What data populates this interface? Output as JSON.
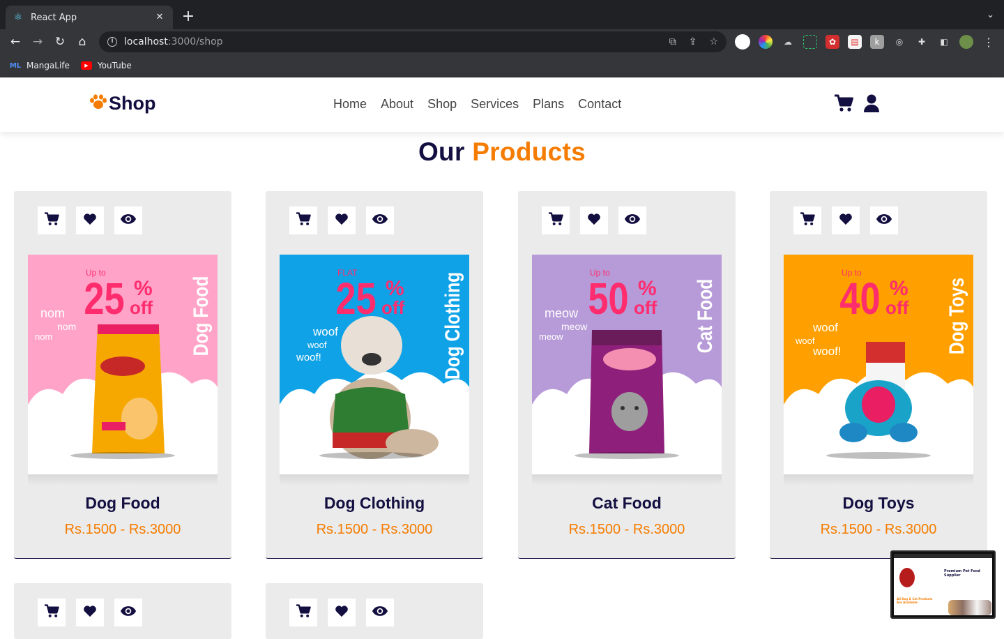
{
  "browser": {
    "tab_title": "React App",
    "new_tab_label": "+",
    "url_host": "localhost",
    "url_path": ":3000/shop",
    "bookmarks": [
      {
        "label": "MangaLife",
        "icon": "mangalife-icon"
      },
      {
        "label": "YouTube",
        "icon": "youtube-icon"
      }
    ]
  },
  "site": {
    "logo_text": "Shop",
    "nav": [
      "Home",
      "About",
      "Shop",
      "Services",
      "Plans",
      "Contact"
    ]
  },
  "section": {
    "title_prefix": "Our",
    "title_accent": "Products"
  },
  "products": [
    {
      "name": "Dog Food",
      "price": "Rs.1500 - Rs.3000",
      "banner": {
        "upto": "Up to",
        "percent": "25",
        "pct": "%",
        "off": "off",
        "side": "Dog Food",
        "sound": [
          "nom",
          "nom",
          "nom"
        ],
        "bg": "#ffa4c8",
        "accent": "#ff2c6e",
        "product_color": "#f6a800"
      }
    },
    {
      "name": "Dog Clothing",
      "price": "Rs.1500 - Rs.3000",
      "banner": {
        "upto": "FLAT",
        "percent": "25",
        "pct": "%",
        "off": "off",
        "side": "Dog Clothing",
        "sound": [
          "woof",
          "woof",
          "woof!"
        ],
        "bg": "#0fa2e6",
        "accent": "#ff2c6e",
        "product_color": "#e53935"
      }
    },
    {
      "name": "Cat Food",
      "price": "Rs.1500 - Rs.3000",
      "banner": {
        "upto": "Up to",
        "percent": "50",
        "pct": "%",
        "off": "off",
        "side": "Cat Food",
        "sound": [
          "meow",
          "meow",
          "meow"
        ],
        "bg": "#b79ad8",
        "accent": "#ff2c6e",
        "product_color": "#8e1f7a"
      }
    },
    {
      "name": "Dog Toys",
      "price": "Rs.1500 - Rs.3000",
      "banner": {
        "upto": "Up to",
        "percent": "40",
        "pct": "%",
        "off": "off",
        "side": "Dog Toys",
        "sound": [
          "woof",
          "woof",
          "woof!"
        ],
        "bg": "#ffa000",
        "accent": "#ff2c6e",
        "product_color": "#1aa3c9"
      }
    }
  ],
  "pip": {
    "title": "Premium Pet Food Supplier",
    "subtitle": "All Dog & Cat Products Are Available"
  }
}
